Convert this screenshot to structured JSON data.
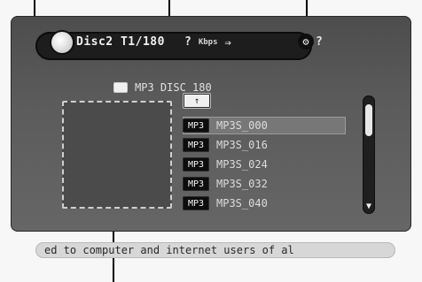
{
  "header": {
    "title": "Disc2 T1/180",
    "status": {
      "q1": "?",
      "kbps": "Kbps",
      "arrow": "⇒"
    },
    "gear_q": "?"
  },
  "path": {
    "label": "MP3 DISC 180"
  },
  "list": {
    "items": [
      {
        "badge": "↑",
        "name": "",
        "type": "up"
      },
      {
        "badge": "MP3",
        "name": "MP3S_000",
        "selected": true
      },
      {
        "badge": "MP3",
        "name": "MP3S_016"
      },
      {
        "badge": "MP3",
        "name": "MP3S_024"
      },
      {
        "badge": "MP3",
        "name": "MP3S_032"
      },
      {
        "badge": "MP3",
        "name": "MP3S_040"
      }
    ]
  },
  "ticker": {
    "text": "ed to computer and internet users of al"
  },
  "icons": {
    "disc": "disc-icon",
    "gear": "gear-icon",
    "folder": "folder-icon",
    "scroll_down": "arrow-down-icon",
    "up_arrow": "arrow-up-icon"
  }
}
